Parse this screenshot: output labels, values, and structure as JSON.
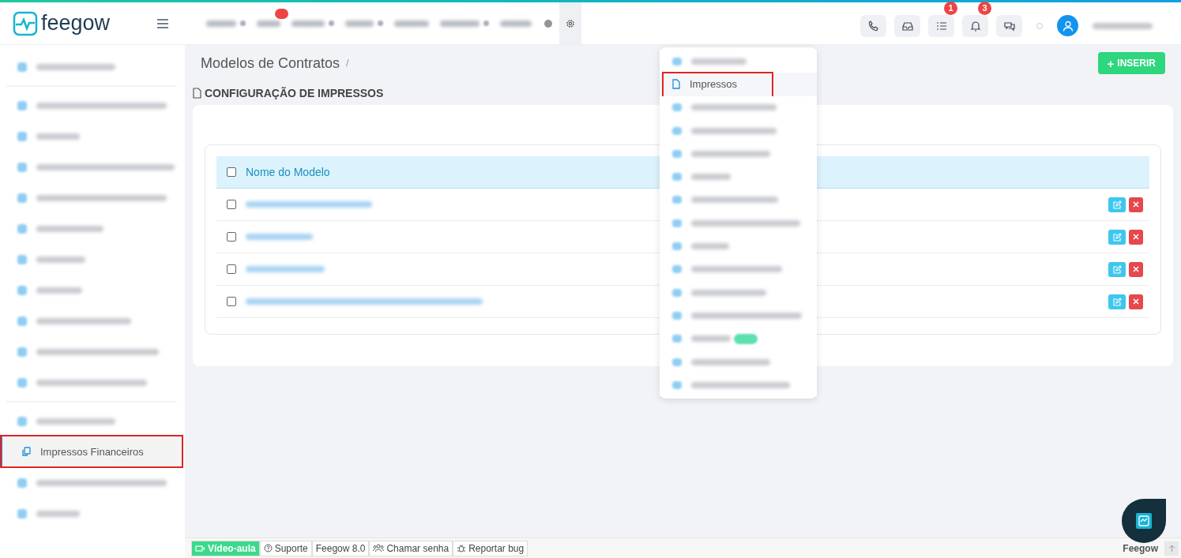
{
  "brand": {
    "name": "feegow"
  },
  "top_nav": [
    {
      "kind": "dropdown"
    },
    {
      "kind": "badged"
    },
    {
      "kind": "dropdown"
    },
    {
      "kind": "dropdown"
    },
    {
      "kind": "link"
    },
    {
      "kind": "dropdown"
    },
    {
      "kind": "link"
    },
    {
      "kind": "dot"
    },
    {
      "kind": "settings"
    }
  ],
  "toolbar": [
    {
      "kind": "phone"
    },
    {
      "kind": "inbox"
    },
    {
      "kind": "list",
      "badge": "1"
    },
    {
      "kind": "bell",
      "badge": "3"
    },
    {
      "kind": "chat"
    }
  ],
  "sidebar": {
    "groups": [
      [
        {
          "kind": "redacted",
          "selected": false
        }
      ],
      [
        {
          "kind": "redacted",
          "selected": false
        },
        {
          "kind": "redacted",
          "selected": false
        },
        {
          "kind": "redacted",
          "selected": false
        },
        {
          "kind": "redacted",
          "selected": false
        },
        {
          "kind": "redacted",
          "selected": false
        },
        {
          "kind": "redacted",
          "selected": false
        },
        {
          "kind": "redacted",
          "selected": false
        },
        {
          "kind": "redacted",
          "selected": false
        },
        {
          "kind": "redacted",
          "selected": false
        },
        {
          "kind": "redacted",
          "selected": false
        }
      ],
      [
        {
          "kind": "redacted",
          "selected": false
        },
        {
          "kind": "label",
          "label": "Impressos Financeiros",
          "selected": true,
          "highlighted": true
        },
        {
          "kind": "redacted",
          "selected": false
        },
        {
          "kind": "redacted",
          "selected": false
        }
      ]
    ]
  },
  "breadcrumb": {
    "title": "Modelos de Contratos",
    "separator": "/"
  },
  "insert_button": {
    "icon": "+",
    "label": "INSERIR"
  },
  "section_title": "CONFIGURAÇÃO DE IMPRESSOS",
  "table": {
    "header_checked": false,
    "columns": [
      "Nome do Modelo"
    ],
    "rows": [
      {
        "checked": false
      },
      {
        "checked": false
      },
      {
        "checked": false
      },
      {
        "checked": false
      }
    ]
  },
  "dropdown": [
    {
      "kind": "redacted",
      "selected": false
    },
    {
      "kind": "label",
      "label": "Impressos",
      "selected": true,
      "highlighted": true
    },
    {
      "kind": "redacted",
      "selected": false
    },
    {
      "kind": "redacted",
      "selected": false
    },
    {
      "kind": "redacted",
      "selected": false
    },
    {
      "kind": "redacted",
      "selected": false
    },
    {
      "kind": "redacted",
      "selected": false
    },
    {
      "kind": "redacted",
      "selected": false
    },
    {
      "kind": "redacted",
      "selected": false
    },
    {
      "kind": "redacted",
      "selected": false
    },
    {
      "kind": "redacted",
      "selected": false
    },
    {
      "kind": "redacted",
      "selected": false
    },
    {
      "kind": "tagged",
      "selected": false
    },
    {
      "kind": "redacted",
      "selected": false
    },
    {
      "kind": "redacted",
      "selected": false
    }
  ],
  "footer": {
    "items": [
      {
        "kind": "video",
        "label": "Vídeo-aula"
      },
      {
        "kind": "help",
        "label": "Suporte"
      },
      {
        "kind": "plain",
        "label": "Feegow 8.0"
      },
      {
        "kind": "people",
        "label": "Chamar senha"
      },
      {
        "kind": "bug",
        "label": "Reportar bug"
      }
    ],
    "brand": "Feegow"
  }
}
